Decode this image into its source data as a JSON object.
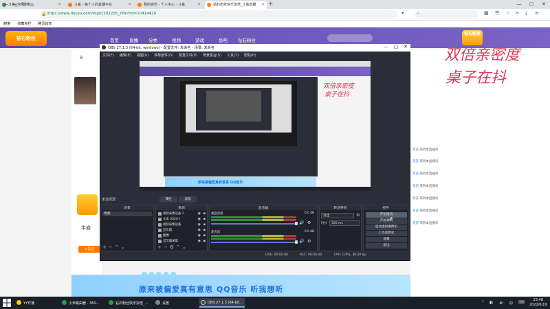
{
  "browser": {
    "tabs": [
      {
        "label": "斗鱼_360搜索",
        "color": "#2e9b3a"
      },
      {
        "label": "斗鱼 - 每个人的直播平台",
        "color": "#ff7a00"
      },
      {
        "label": "我的资料 - 个人中心 - 斗鱼",
        "color": "#ff7a00"
      },
      {
        "label": "钻石粉丝快乐加倍_斗鱼直播",
        "color": "#ff7a00"
      }
    ],
    "new_tab": "+",
    "url": "https://www.douyu.com/topic/202205_YJW?rid=10414420",
    "bookmarks": [
      "j搜索",
      "收藏夹栏",
      "腾讯体育"
    ],
    "window_controls": [
      "—",
      "▢",
      "✕"
    ]
  },
  "page": {
    "nav_links": [
      "首页",
      "直播",
      "分类",
      "视频",
      "游戏",
      "鱼吧",
      "钻石粉丝"
    ],
    "logo_text": "钻石粉丝",
    "big_text_1": "双倍亲密度",
    "big_text_2": "桌子在抖",
    "count_badge": "8",
    "streamer_name": "牛岩",
    "follow_label": "+关注",
    "bottom_banner": "原来被偏爱真有意思  QQ音乐 听我想听",
    "chat_lines": [
      {
        "user": "欢迎",
        "text": "来到本直播间"
      },
      {
        "user": "欢迎",
        "text": "来到本直播间"
      },
      {
        "user": "欢迎",
        "text": "来到本直播间"
      },
      {
        "user": "欢迎",
        "text": "来到本直播间"
      },
      {
        "user": "欢迎",
        "text": "来到本直播间"
      },
      {
        "user": "欢迎",
        "text": "来到本直播间"
      },
      {
        "user": "欢迎",
        "text": "来到本直播间"
      }
    ]
  },
  "obs": {
    "title": "OBS 27.1.3 (64-bit, windows) - 配置文件: 未命名 - 场景: 未命名",
    "menu": [
      "文件(F)",
      "编辑(E)",
      "视图(V)",
      "停靠部件(D)",
      "配置文件(P)",
      "场景集合(S)",
      "工具(T)",
      "帮助(H)"
    ],
    "preview_text_1": "双倍亲密度",
    "preview_text_2": "桌子在抖",
    "preview_bottom": "原来被偏爱真有意思  QQ音乐",
    "selected_source": "未选择源",
    "props_label": "属性",
    "filter_label": "滤镜",
    "docks": {
      "scenes": "场景",
      "sources": "来源",
      "mixer": "混音器",
      "transitions": "转场特效",
      "controls": "控件"
    },
    "scene_items": [
      "场景"
    ],
    "source_items": [
      "视频采集设备 2",
      "文本 (GDI+)",
      "视频采集设备",
      "显示器",
      "图像",
      "显示器采集"
    ],
    "mixer": [
      {
        "name": "桌面音频",
        "db": "0.0 dB"
      },
      {
        "name": "麦克风",
        "db": "0.0 dB"
      }
    ],
    "transition": "淡出",
    "duration_label": "时长",
    "duration_value": "300 ms",
    "control_buttons": [
      "开始推流",
      "开始录制",
      "启动虚拟摄像机",
      "工作室模式",
      "设置",
      "退出"
    ],
    "status": {
      "live": "LIVE: 00:00:00",
      "rec": "REC: 00:00:00",
      "cpu": "CPU: 0.9%, 30.00 fps"
    }
  },
  "taskbar": {
    "items": [
      {
        "label": "YY开播",
        "color": "#ffcc00"
      },
      {
        "label": "小米路由器 - 360...",
        "color": "#2e9b3a"
      },
      {
        "label": "钻石粉丝快乐加倍_...",
        "color": "#2e9b3a"
      },
      {
        "label": "设置",
        "color": "#888888"
      },
      {
        "label": "OBS 27.1.3 (64-bit...",
        "color": "#444444"
      }
    ],
    "time": "23:48",
    "date": "2022/6/19"
  }
}
